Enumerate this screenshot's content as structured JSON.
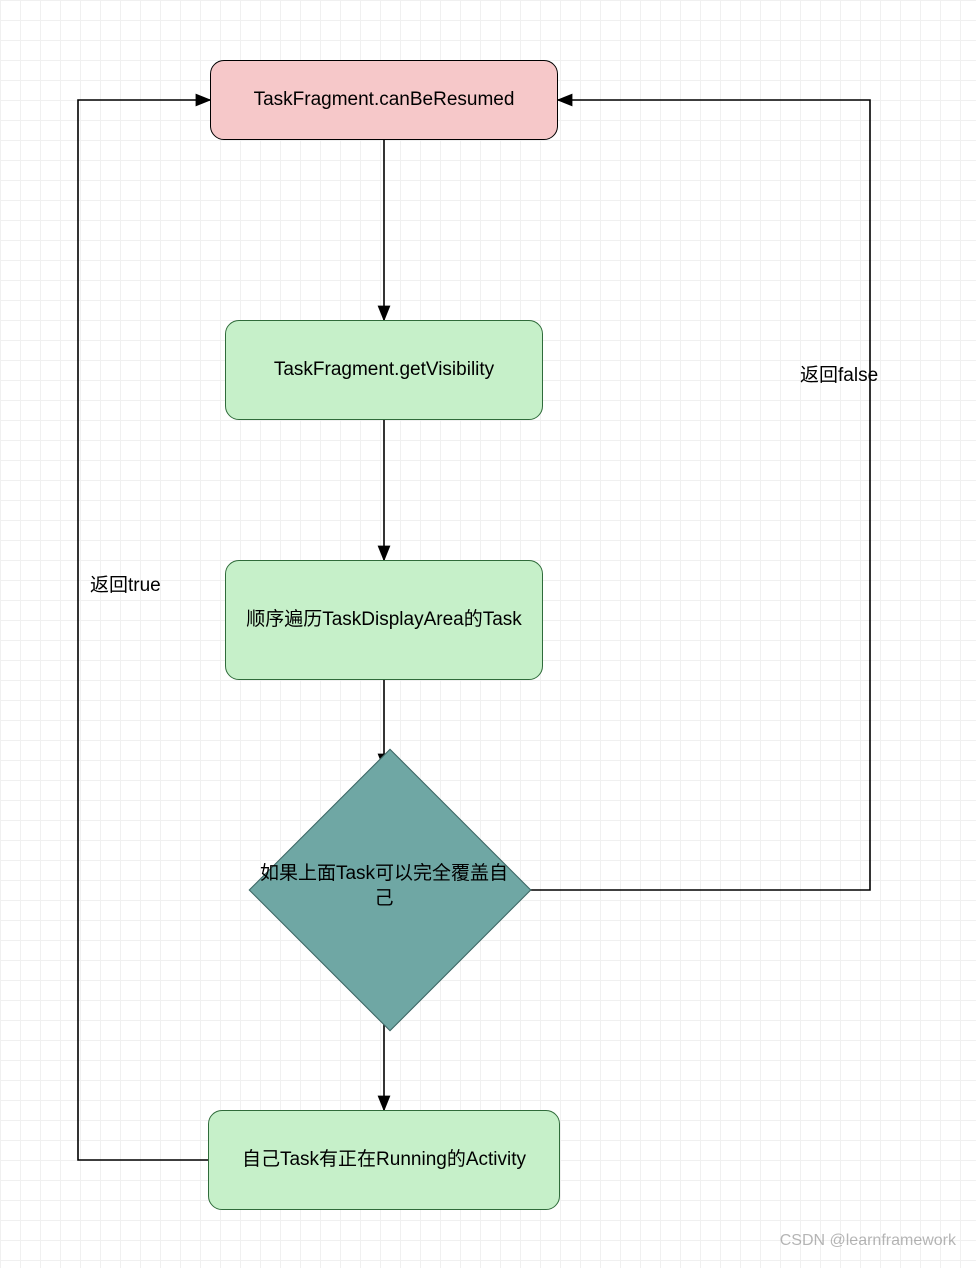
{
  "nodes": {
    "start": {
      "label": "TaskFragment.canBeResumed"
    },
    "getVisibility": {
      "label": "TaskFragment.getVisibility"
    },
    "iterate": {
      "label": "顺序遍历TaskDisplayArea的Task"
    },
    "decision": {
      "label": "如果上面Task可以完全覆盖自己"
    },
    "running": {
      "label": "自己Task有正在Running的Activity"
    }
  },
  "edges": {
    "returnTrue": {
      "label": "返回true"
    },
    "returnFalse": {
      "label": "返回false"
    }
  },
  "watermark": "CSDN @learnframework",
  "colors": {
    "pinkFill": "#f6c8c9",
    "greenFill": "#c6f0c9",
    "greenStroke": "#2f6b3a",
    "tealFill": "#6fa7a4",
    "tealStroke": "#3a6260",
    "gridMinor": "#f0f0f0",
    "gridMajor": "#e0e0e0"
  }
}
